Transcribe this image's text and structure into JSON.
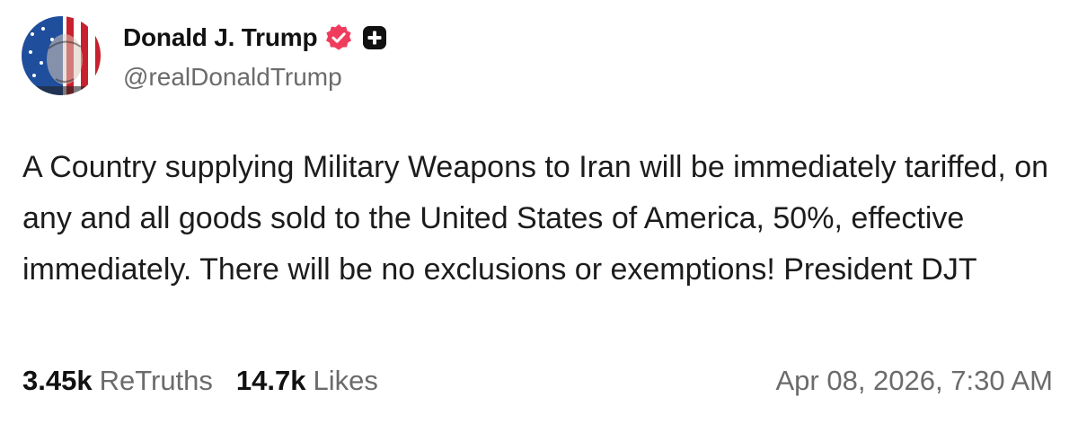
{
  "author": {
    "display_name": "Donald J. Trump",
    "handle": "@realDonaldTrump",
    "verified_icon": "verified-badge-icon",
    "badge_icon": "plus-badge-icon",
    "colors": {
      "verified_badge": "#ef3c5d",
      "plus_badge": "#111111"
    }
  },
  "post": {
    "text": "A Country supplying Military Weapons to Iran will be immediately tariffed, on any and all goods sold to the United States of America, 50%, effective immediately. There will be no exclusions or exemptions! President DJT"
  },
  "stats": {
    "retruths_count": "3.45k",
    "retruths_label": "ReTruths",
    "likes_count": "14.7k",
    "likes_label": "Likes"
  },
  "timestamp": "Apr 08, 2026, 7:30 AM"
}
